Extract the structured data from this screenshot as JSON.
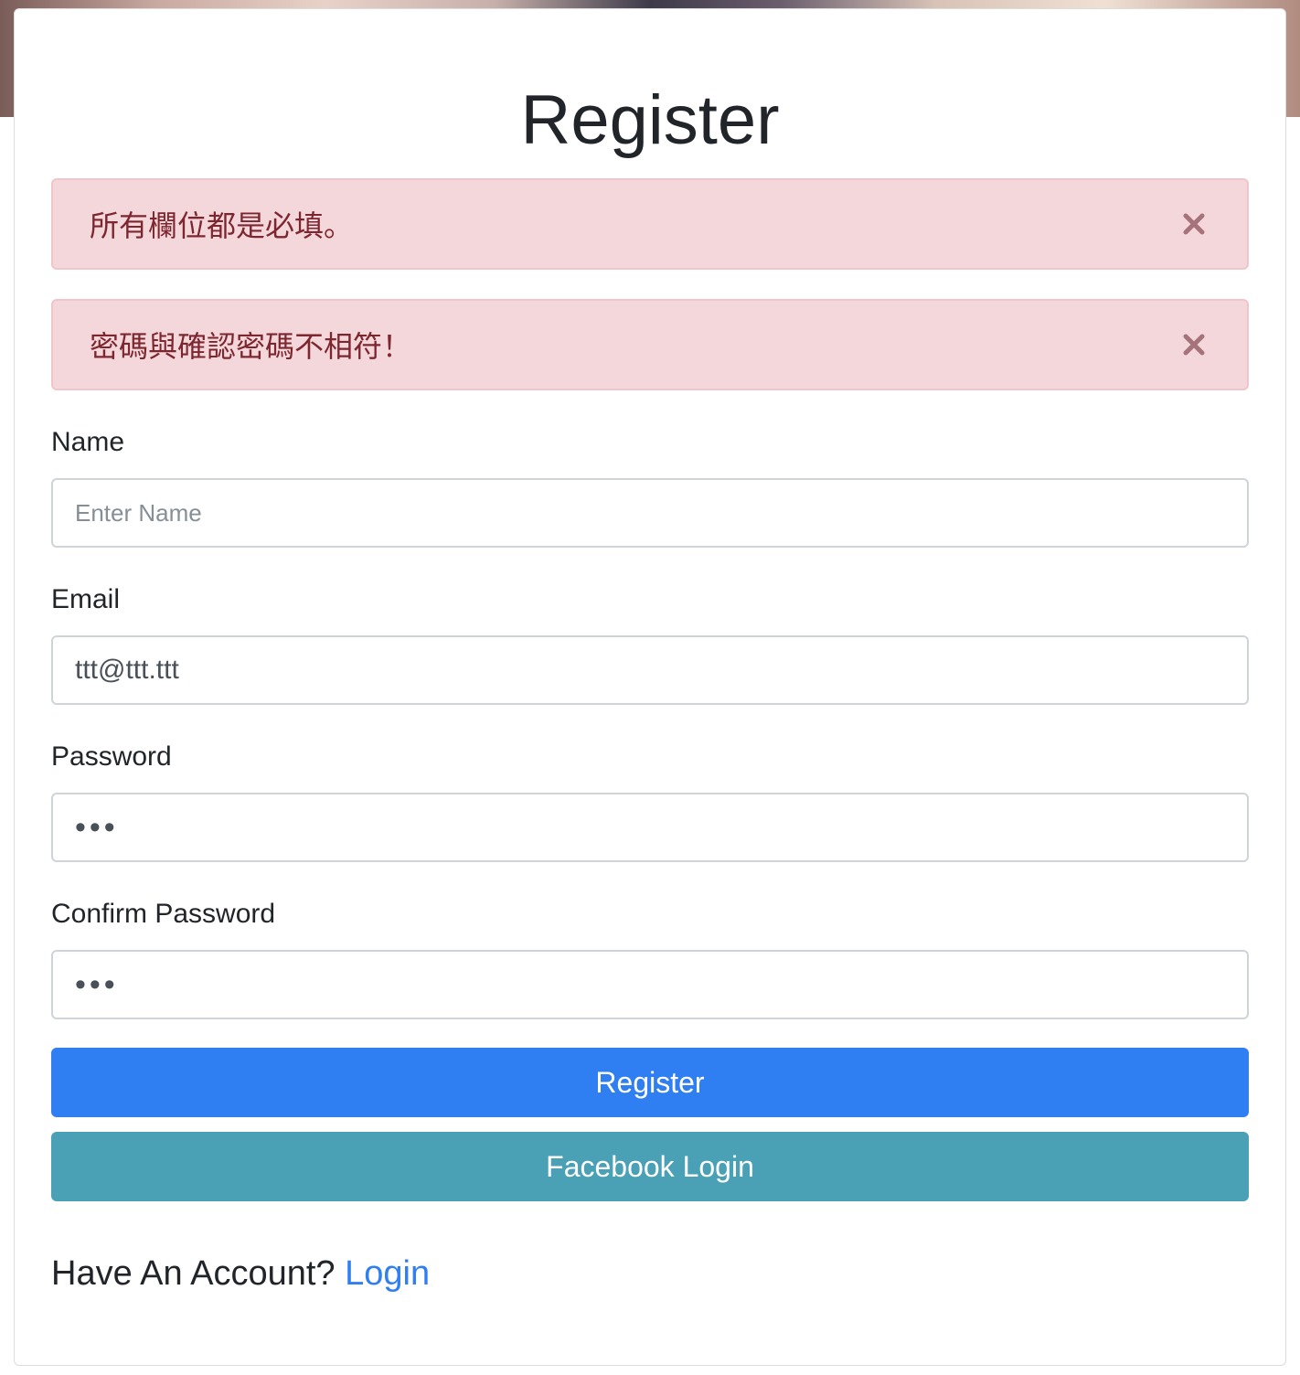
{
  "page": {
    "title": "Register"
  },
  "alerts": [
    {
      "message": "所有欄位都是必填。"
    },
    {
      "message": "密碼與確認密碼不相符！"
    }
  ],
  "form": {
    "name": {
      "label": "Name",
      "placeholder": "Enter Name",
      "value": ""
    },
    "email": {
      "label": "Email",
      "placeholder": "",
      "value": "ttt@ttt.ttt"
    },
    "password": {
      "label": "Password",
      "value": "abc"
    },
    "confirm_password": {
      "label": "Confirm Password",
      "value": "abc"
    }
  },
  "buttons": {
    "register_label": "Register",
    "facebook_label": "Facebook Login"
  },
  "footer": {
    "prompt": "Have An Account?",
    "login_link": "Login"
  },
  "colors": {
    "primary": "#2f7ef2",
    "info": "#4aa0b5",
    "alert_bg": "#f3d7da",
    "alert_text": "#7d2630"
  },
  "icons": {
    "alert_close": "close-icon"
  }
}
